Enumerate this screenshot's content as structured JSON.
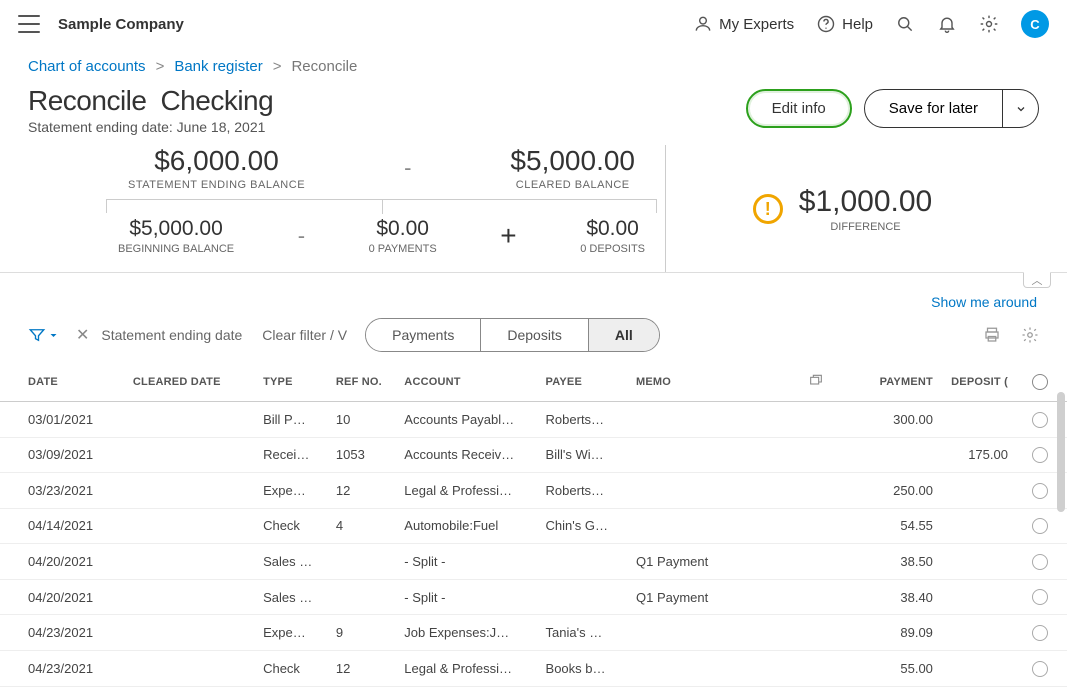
{
  "header": {
    "company": "Sample Company",
    "links": {
      "myExperts": "My Experts",
      "help": "Help"
    },
    "avatar": "C"
  },
  "breadcrumb": {
    "item1": "Chart of accounts",
    "item2": "Bank register",
    "current": "Reconcile"
  },
  "page": {
    "title": "Reconcile",
    "account": "Checking",
    "subtitlePrefix": "Statement ending date: ",
    "subtitleDate": "June 18, 2021",
    "editInfo": "Edit info",
    "saveForLater": "Save for later"
  },
  "balances": {
    "statementEnding": {
      "amount": "$6,000.00",
      "label": "STATEMENT ENDING BALANCE"
    },
    "cleared": {
      "amount": "$5,000.00",
      "label": "CLEARED BALANCE"
    },
    "beginning": {
      "amount": "$5,000.00",
      "label": "BEGINNING BALANCE"
    },
    "payments": {
      "amount": "$0.00",
      "label": "0 PAYMENTS"
    },
    "deposits": {
      "amount": "$0.00",
      "label": "0 DEPOSITS"
    },
    "difference": {
      "amount": "$1,000.00",
      "label": "DIFFERENCE"
    },
    "minus": "-",
    "plus": "+"
  },
  "showMe": "Show me around",
  "filter": {
    "chipLabel": "Statement ending date",
    "clear": "Clear filter / V"
  },
  "tabs": {
    "payments": "Payments",
    "deposits": "Deposits",
    "all": "All"
  },
  "columns": {
    "date": "DATE",
    "cleared": "CLEARED DATE",
    "type": "TYPE",
    "ref": "REF NO.",
    "account": "ACCOUNT",
    "payee": "PAYEE",
    "memo": "MEMO",
    "payment": "PAYMENT",
    "deposit": "DEPOSIT ("
  },
  "rows": [
    {
      "date": "03/01/2021",
      "cleared": "",
      "type": "Bill P…",
      "ref": "10",
      "account": "Accounts Payabl…",
      "payee": "Roberts…",
      "memo": "",
      "payment": "300.00",
      "deposit": ""
    },
    {
      "date": "03/09/2021",
      "cleared": "",
      "type": "Recei…",
      "ref": "1053",
      "account": "Accounts Receiv…",
      "payee": "Bill's Wi…",
      "memo": "",
      "payment": "",
      "deposit": "175.00"
    },
    {
      "date": "03/23/2021",
      "cleared": "",
      "type": "Expe…",
      "ref": "12",
      "account": "Legal & Professi…",
      "payee": "Roberts…",
      "memo": "",
      "payment": "250.00",
      "deposit": ""
    },
    {
      "date": "04/14/2021",
      "cleared": "",
      "type": "Check",
      "ref": "4",
      "account": "Automobile:Fuel",
      "payee": "Chin's G…",
      "memo": "",
      "payment": "54.55",
      "deposit": ""
    },
    {
      "date": "04/20/2021",
      "cleared": "",
      "type": "Sales …",
      "ref": "",
      "account": "- Split -",
      "payee": "",
      "memo": "Q1 Payment",
      "payment": "38.50",
      "deposit": ""
    },
    {
      "date": "04/20/2021",
      "cleared": "",
      "type": "Sales …",
      "ref": "",
      "account": "- Split -",
      "payee": "",
      "memo": "Q1 Payment",
      "payment": "38.40",
      "deposit": ""
    },
    {
      "date": "04/23/2021",
      "cleared": "",
      "type": "Expe…",
      "ref": "9",
      "account": "Job Expenses:J…",
      "payee": "Tania's …",
      "memo": "",
      "payment": "89.09",
      "deposit": ""
    },
    {
      "date": "04/23/2021",
      "cleared": "",
      "type": "Check",
      "ref": "12",
      "account": "Legal & Professi…",
      "payee": "Books b…",
      "memo": "",
      "payment": "55.00",
      "deposit": ""
    }
  ]
}
